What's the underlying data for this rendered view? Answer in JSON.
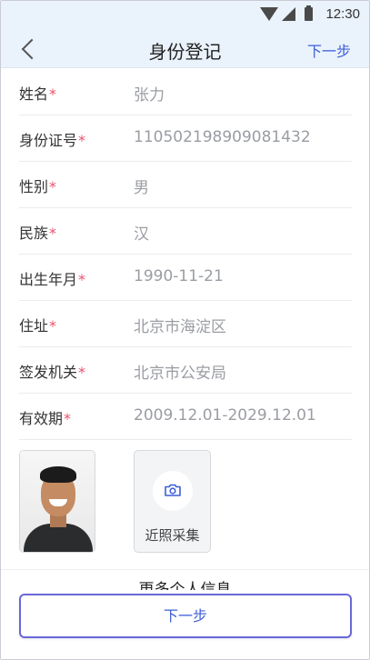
{
  "status_bar": {
    "time": "12:30"
  },
  "nav": {
    "title": "身份登记",
    "next_label": "下一步"
  },
  "required_mark": "*",
  "fields": [
    {
      "label": "姓名",
      "value": "张力"
    },
    {
      "label": "身份证号",
      "value": "110502198909081432"
    },
    {
      "label": "性别",
      "value": "男"
    },
    {
      "label": "民族",
      "value": "汉"
    },
    {
      "label": "出生年月",
      "value": "1990-11-21"
    },
    {
      "label": "住址",
      "value": "北京市海淀区"
    },
    {
      "label": "签发机关",
      "value": "北京市公安局"
    },
    {
      "label": "有效期",
      "value": "2009.12.01-2029.12.01"
    }
  ],
  "photo_upload": {
    "label": "近照采集",
    "icon": "camera-icon"
  },
  "more_info_label": "更多个人信息",
  "bottom_button": {
    "label": "下一步"
  },
  "colors": {
    "accent": "#3d5fd9",
    "required": "#e8516d",
    "value_text": "#9a9da3",
    "nav_bg": "#eaf2fb"
  }
}
